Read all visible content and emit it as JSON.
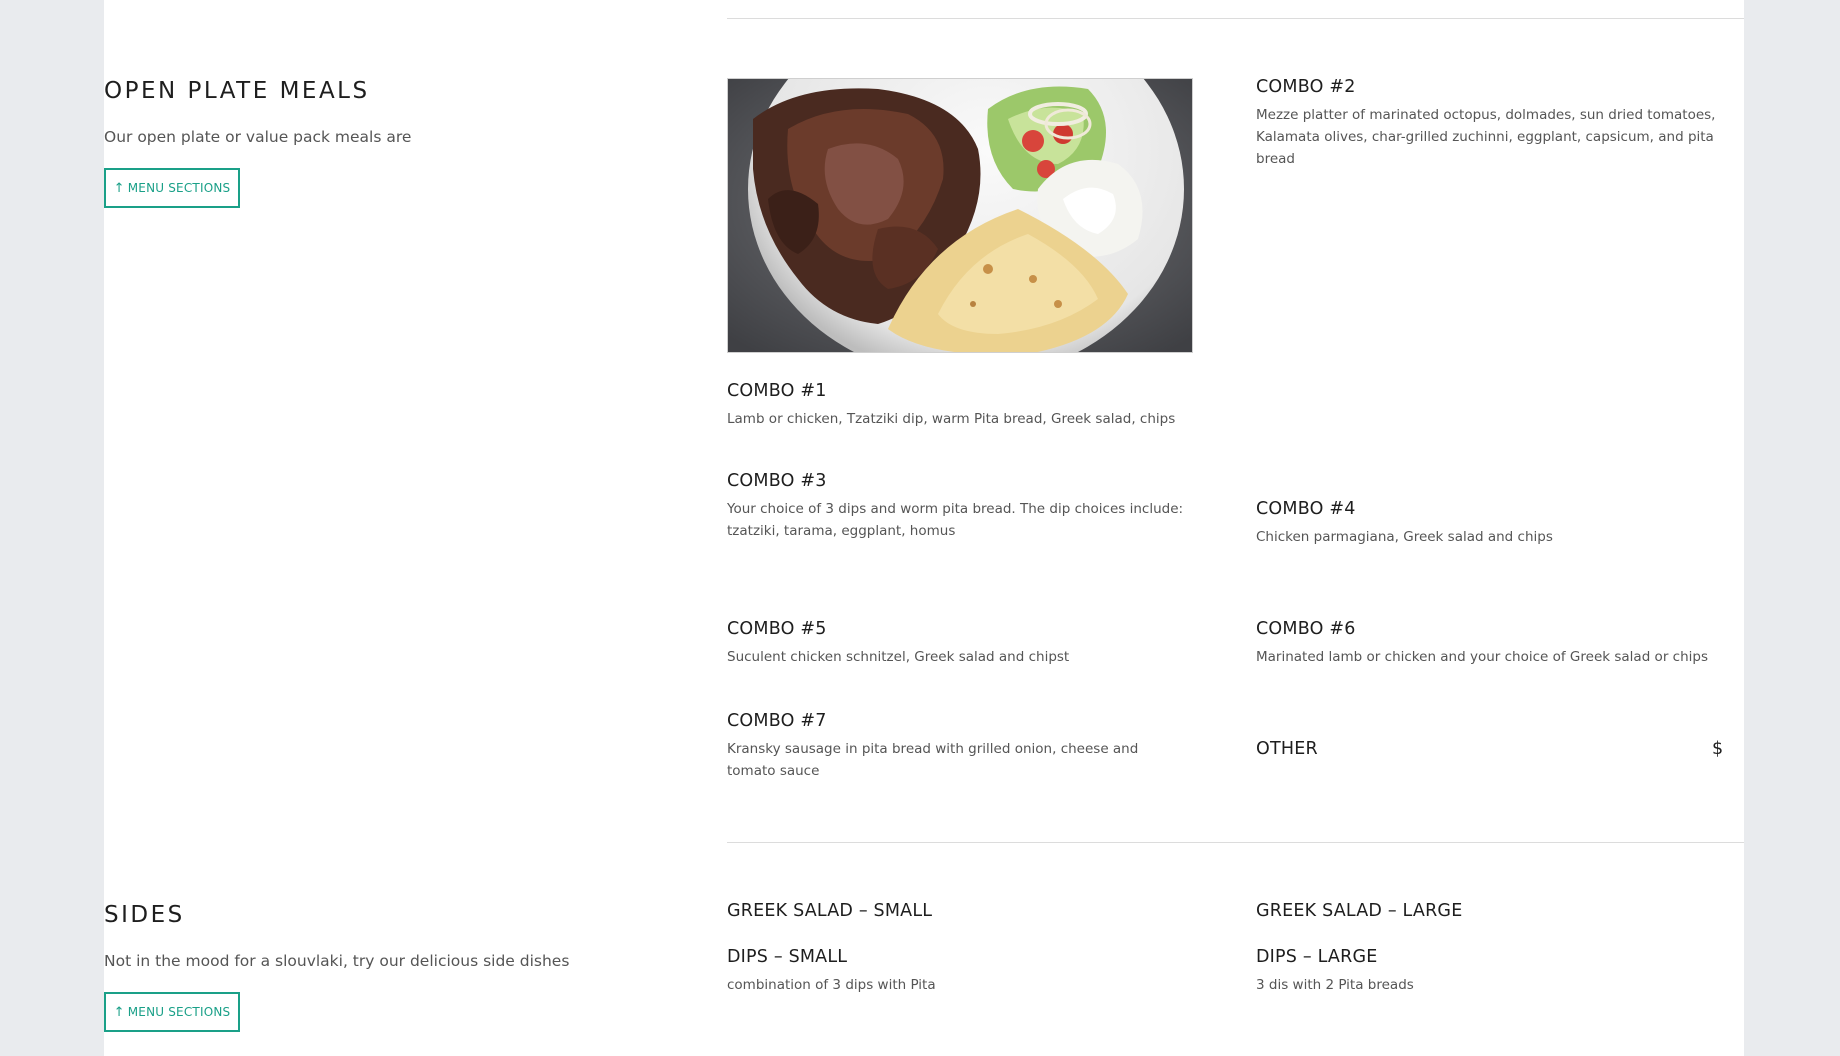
{
  "open_plate": {
    "title": "OPEN PLATE MEALS",
    "description": "Our open plate or value pack meals are",
    "menu_button": {
      "arrow": "↑",
      "label": "MENU SECTIONS"
    },
    "items": {
      "combo1": {
        "title": "COMBO #1",
        "desc": "Lamb or chicken, Tzatziki dip, warm Pita bread, Greek salad, chips"
      },
      "combo2": {
        "title": "COMBO #2",
        "desc": "Mezze platter of marinated octopus, dolmades, sun dried tomatoes, Kalamata olives, char-grilled zuchinni, eggplant, capsicum, and pita bread"
      },
      "combo3": {
        "title": "COMBO #3",
        "desc": "Your choice of 3 dips and worm pita bread. The dip choices include: tzatziki, tarama, eggplant, homus"
      },
      "combo4": {
        "title": "COMBO #4",
        "desc": "Chicken parmagiana, Greek salad and chips"
      },
      "combo5": {
        "title": "COMBO #5",
        "desc": "Suculent chicken schnitzel, Greek salad and chipst"
      },
      "combo6": {
        "title": "COMBO #6",
        "desc": "Marinated lamb or chicken and your choice of Greek salad or chips"
      },
      "combo7": {
        "title": "COMBO #7",
        "desc": "Kransky sausage in pita bread with grilled onion, cheese and tomato sauce"
      },
      "other": {
        "title": "OTHER",
        "price": "$"
      }
    }
  },
  "sides": {
    "title": "SIDES",
    "description": "Not in the mood for a slouvlaki, try our delicious side dishes",
    "menu_button": {
      "arrow": "↑",
      "label": "MENU SECTIONS"
    },
    "items": {
      "salad_small": {
        "title": "GREEK SALAD – SMALL"
      },
      "salad_large": {
        "title": "GREEK SALAD – LARGE"
      },
      "dips_small": {
        "title": "DIPS – SMALL",
        "desc": "combination of 3 dips with Pita"
      },
      "dips_large": {
        "title": "DIPS – LARGE",
        "desc": "3 dis with 2 Pita breads"
      }
    }
  },
  "colors": {
    "accent": "#1aa088",
    "background": "#e9ebee",
    "page": "#ffffff"
  }
}
